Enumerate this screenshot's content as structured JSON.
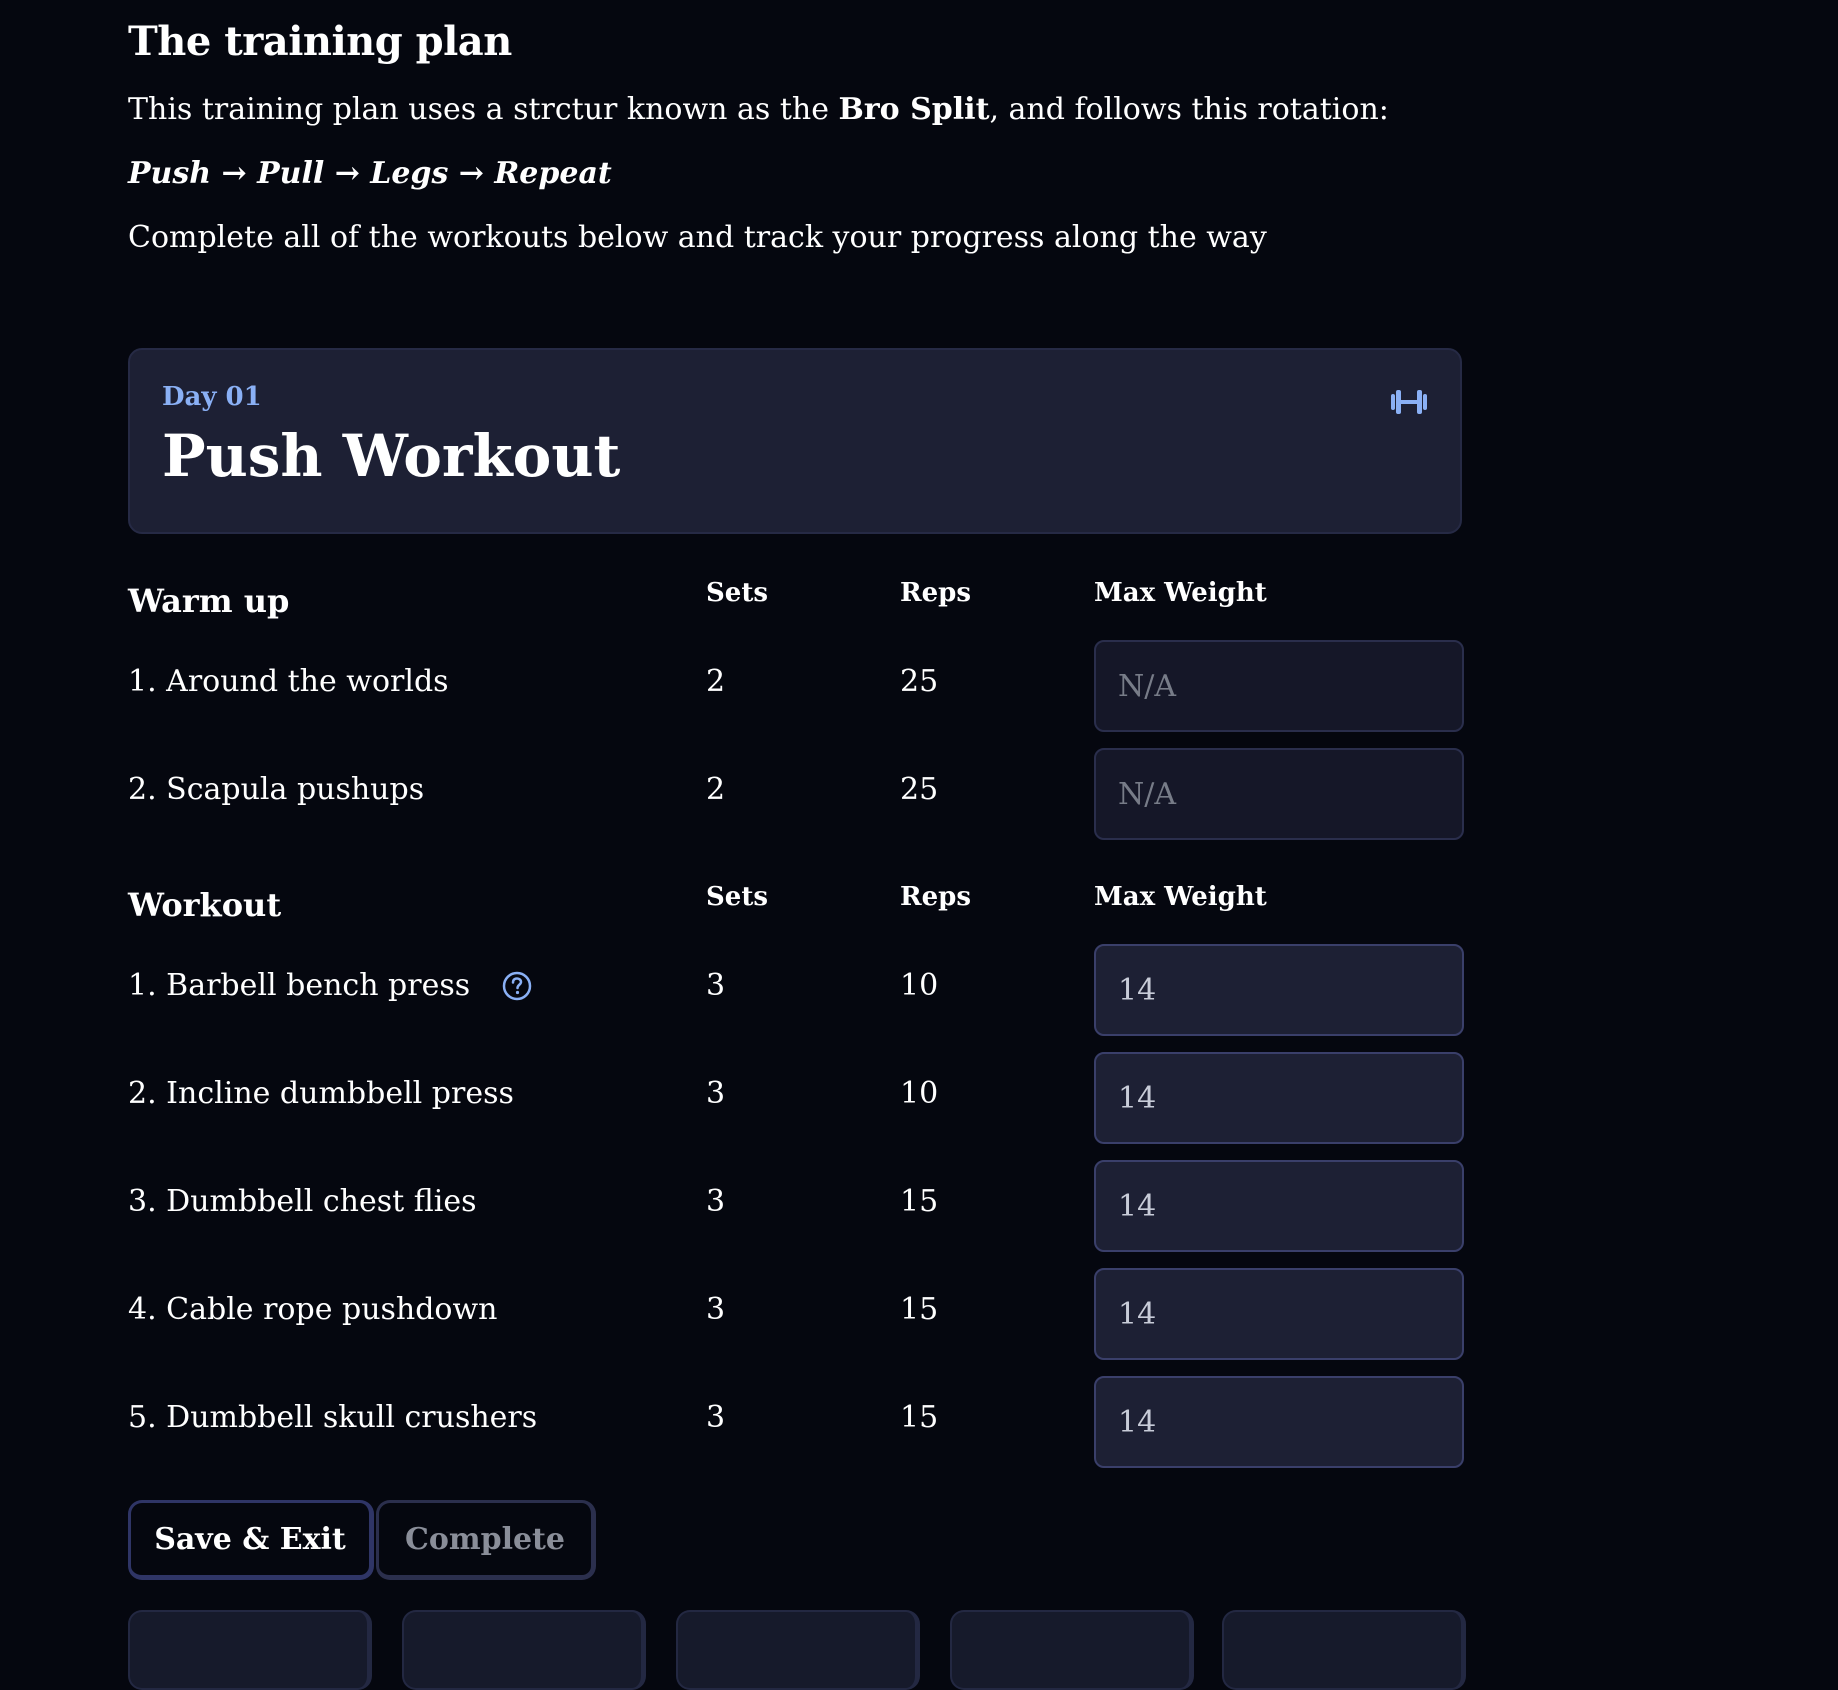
{
  "plan": {
    "title": "The training plan",
    "intro_before": "This training plan uses a strctur known as the ",
    "intro_bold": "Bro Split",
    "intro_after": ", and follows this rotation:",
    "rotation": "Push → Pull → Legs → Repeat",
    "note": "Complete all of the workouts below and track your progress along the way"
  },
  "day_card": {
    "day_label": "Day 01",
    "workout_name": "Push Workout",
    "icon": "dumbbell-icon"
  },
  "columns": {
    "sets": "Sets",
    "reps": "Reps",
    "max_weight": "Max Weight"
  },
  "warmup": {
    "title": "Warm up",
    "exercises": [
      {
        "name": "1. Around the worlds",
        "sets": "2",
        "reps": "25",
        "weight": "",
        "placeholder": "N/A"
      },
      {
        "name": "2. Scapula pushups",
        "sets": "2",
        "reps": "25",
        "weight": "",
        "placeholder": "N/A"
      }
    ]
  },
  "workout": {
    "title": "Workout",
    "help_icon": "help-circle-icon",
    "exercises": [
      {
        "name": "1. Barbell bench press",
        "sets": "3",
        "reps": "10",
        "weight": "14"
      },
      {
        "name": "2. Incline dumbbell press",
        "sets": "3",
        "reps": "10",
        "weight": "14"
      },
      {
        "name": "3. Dumbbell chest flies",
        "sets": "3",
        "reps": "15",
        "weight": "14"
      },
      {
        "name": "4. Cable rope pushdown",
        "sets": "3",
        "reps": "15",
        "weight": "14"
      },
      {
        "name": "5. Dumbbell skull crushers",
        "sets": "3",
        "reps": "15",
        "weight": "14"
      }
    ]
  },
  "buttons": {
    "save_exit": "Save & Exit",
    "complete": "Complete"
  },
  "colors": {
    "background": "#05070f",
    "card": "#1d2034",
    "accent": "#8ab0f5"
  }
}
